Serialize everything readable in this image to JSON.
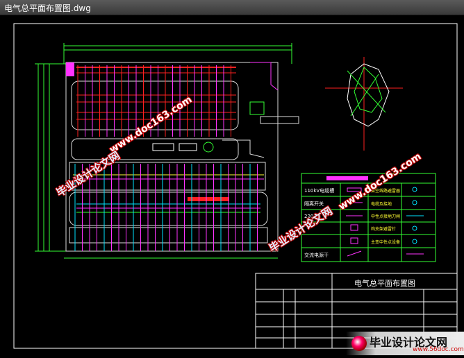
{
  "window": {
    "title": "电气总平面布置图.dwg"
  },
  "legend": {
    "rows": [
      {
        "label": "110kV电缆槽",
        "desc": "架空线路避雷器"
      },
      {
        "label": "隔离开关",
        "desc": "电缆及接地"
      },
      {
        "label": "220",
        "desc": "中性点接地刀闸"
      },
      {
        "label": "",
        "desc": "构支架避雷针"
      },
      {
        "label": "",
        "desc": "主变中性点设备"
      },
      {
        "label": "交流电源干",
        "desc": ""
      }
    ]
  },
  "title_block": {
    "drawing_title": "电气总平面布置图"
  },
  "watermarks": {
    "brand": "毕业设计论文网",
    "url": "www.doc163.com"
  },
  "logo": {
    "text": "毕业设计论文网",
    "url": "www.56doc.com"
  },
  "colors": {
    "background": "#000000",
    "frame": "#ffffff",
    "red": "#ff2020",
    "magenta": "#ff33ff",
    "green": "#33ff33",
    "cyan": "#00e5ff",
    "yellow": "#ffff33"
  }
}
